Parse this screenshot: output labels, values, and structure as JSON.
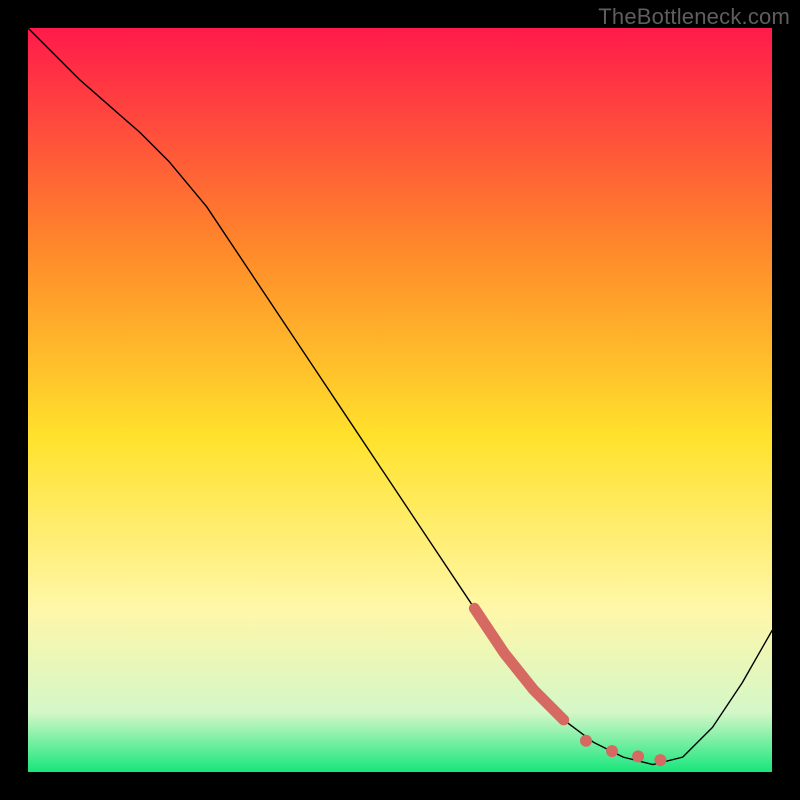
{
  "watermark": "TheBottleneck.com",
  "chart_data": {
    "type": "line",
    "title": "",
    "xlabel": "",
    "ylabel": "",
    "xlim": [
      0,
      100
    ],
    "ylim": [
      0,
      100
    ],
    "grid": false,
    "legend": false,
    "background_gradient": {
      "top": "#ff1a4b",
      "upper_mid": "#ff8a2a",
      "mid": "#ffe22c",
      "lower_mid": "#fff7a8",
      "near_bottom": "#d4f7c8",
      "bottom": "#17e67c"
    },
    "series": [
      {
        "name": "curve",
        "color": "#000000",
        "width": 1.4,
        "x": [
          0,
          7,
          15,
          19,
          24,
          30,
          36,
          42,
          48,
          54,
          60,
          64,
          68,
          72,
          76,
          80,
          84,
          88,
          92,
          96,
          100
        ],
        "y": [
          100,
          93,
          86,
          82,
          76,
          67,
          58,
          49,
          40,
          31,
          22,
          16,
          11,
          7,
          4,
          2,
          1,
          2,
          6,
          12,
          19
        ]
      },
      {
        "name": "highlight-stroke",
        "color": "#d66a63",
        "width": 11,
        "x": [
          60,
          62,
          64,
          66,
          68,
          70,
          72
        ],
        "y": [
          22,
          19,
          16,
          13.5,
          11,
          9,
          7
        ]
      },
      {
        "name": "highlight-dots",
        "color": "#d66a63",
        "marker_size": 6,
        "x": [
          75,
          78.5,
          82,
          85
        ],
        "y": [
          4.2,
          2.8,
          2.1,
          1.6
        ]
      }
    ]
  }
}
